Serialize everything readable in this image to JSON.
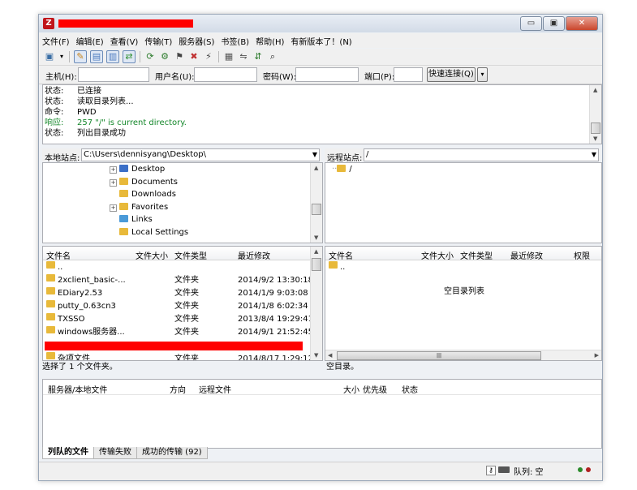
{
  "window": {
    "title_redacted": true,
    "controls": [
      "▭",
      "▣",
      "✕"
    ]
  },
  "menu": [
    "文件(F)",
    "编辑(E)",
    "查看(V)",
    "传输(T)",
    "服务器(S)",
    "书签(B)",
    "帮助(H)",
    "有新版本了！(N)"
  ],
  "toolbar_icons": [
    "site-manager-icon",
    "dropdown-icon",
    "toggle-log-icon",
    "toggle-local-tree-icon",
    "toggle-remote-tree-icon",
    "toggle-queue-icon",
    "refresh-icon",
    "process-queue-icon",
    "cancel-icon",
    "disconnect-icon",
    "reconnect-icon",
    "filter-icon",
    "compare-icon",
    "sync-browse-icon",
    "search-icon"
  ],
  "quickconnect": {
    "host_label": "主机(H):",
    "user_label": "用户名(U):",
    "pass_label": "密码(W):",
    "port_label": "端口(P):",
    "button": "快速连接(Q)"
  },
  "log": [
    {
      "key": "状态:",
      "msg": "已连接",
      "color": "#000000"
    },
    {
      "key": "状态:",
      "msg": "读取目录列表...",
      "color": "#000000"
    },
    {
      "key": "命令:",
      "msg": "PWD",
      "color": "#000000"
    },
    {
      "key": "响应:",
      "msg": "257 \"/\" is current directory.",
      "color": "#14872a"
    },
    {
      "key": "状态:",
      "msg": "列出目录成功",
      "color": "#000000"
    }
  ],
  "local": {
    "label": "本地站点:",
    "path": "C:\\Users\\dennisyang\\Desktop\\",
    "tree": [
      {
        "name": "Desktop",
        "expand": "+",
        "icon": "blue"
      },
      {
        "name": "Documents",
        "expand": "+",
        "icon": "yellow"
      },
      {
        "name": "Downloads",
        "expand": "",
        "icon": "yellow"
      },
      {
        "name": "Favorites",
        "expand": "+",
        "icon": "yellow"
      },
      {
        "name": "Links",
        "expand": "",
        "icon": "yellow"
      },
      {
        "name": "Local Settings",
        "expand": "",
        "icon": "yellow"
      }
    ],
    "columns": [
      "文件名",
      "文件大小",
      "文件类型",
      "最近修改"
    ],
    "files": [
      {
        "name": "..",
        "size": "",
        "type": "",
        "modified": ""
      },
      {
        "name": "2xclient_basic-...",
        "size": "",
        "type": "文件夹",
        "modified": "2014/9/2 13:30:18"
      },
      {
        "name": "EDiary2.53",
        "size": "",
        "type": "文件夹",
        "modified": "2014/1/9 9:03:08"
      },
      {
        "name": "putty_0.63cn3",
        "size": "",
        "type": "文件夹",
        "modified": "2014/1/8 6:02:34"
      },
      {
        "name": "TXSSO",
        "size": "",
        "type": "文件夹",
        "modified": "2013/8/4 19:29:41"
      },
      {
        "name": "windows服务器...",
        "size": "",
        "type": "文件夹",
        "modified": "2014/9/1 21:52:45"
      }
    ],
    "partial_row": {
      "name": "杂项文件",
      "type": "文件夹",
      "modified": "2014/8/17 1:29:12"
    },
    "status": "选择了 1 个文件夹。"
  },
  "remote": {
    "label": "远程站点:",
    "path": "/",
    "tree_root": "/",
    "columns": [
      "文件名",
      "文件大小",
      "文件类型",
      "最近修改",
      "权限"
    ],
    "files": [
      {
        "name": ".."
      }
    ],
    "empty_message": "空目录列表",
    "status": "空目录。"
  },
  "queue": {
    "columns": [
      "服务器/本地文件",
      "方向",
      "远程文件",
      "大小",
      "优先级",
      "状态"
    ],
    "tabs": [
      "列队的文件",
      "传输失败",
      "成功的传输 (92)"
    ]
  },
  "statusbar": {
    "queue_text": "队列: 空"
  }
}
